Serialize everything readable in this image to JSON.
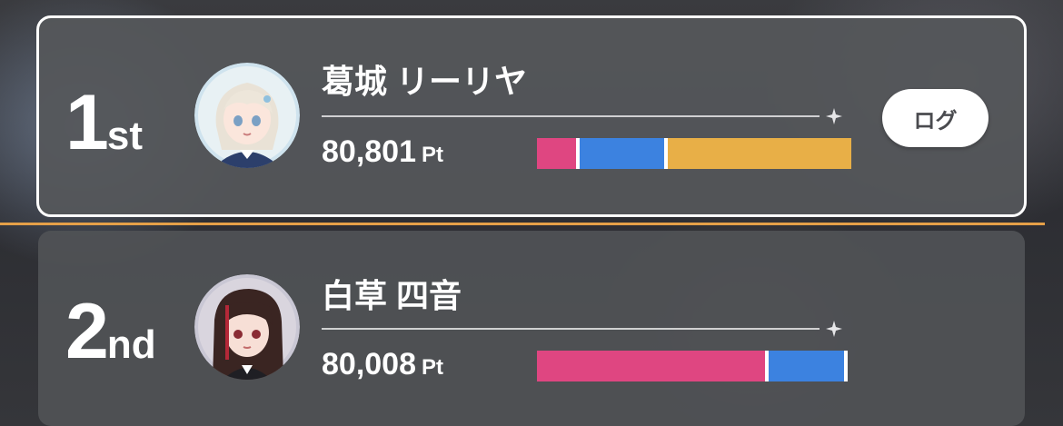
{
  "colors": {
    "pink": "#df4681",
    "blue": "#3c82e0",
    "orange": "#e8af47",
    "divider": "#e5a048"
  },
  "rows": [
    {
      "rank_num": "1",
      "rank_suffix": "st",
      "name": "葛城 リーリヤ",
      "points": "80,801",
      "unit": "Pt",
      "avatar": "character-portrait",
      "button_label": "ログ",
      "bar": [
        {
          "color": "pink",
          "fraction": 0.135
        },
        {
          "color": "blue",
          "fraction": 0.28
        },
        {
          "color": "orange",
          "fraction": 0.585
        }
      ]
    },
    {
      "rank_num": "2",
      "rank_suffix": "nd",
      "name": "白草 四音",
      "points": "80,008",
      "unit": "Pt",
      "avatar": "character-portrait",
      "bar": [
        {
          "color": "pink",
          "fraction": 0.745
        },
        {
          "color": "blue",
          "fraction": 0.255
        }
      ]
    }
  ]
}
